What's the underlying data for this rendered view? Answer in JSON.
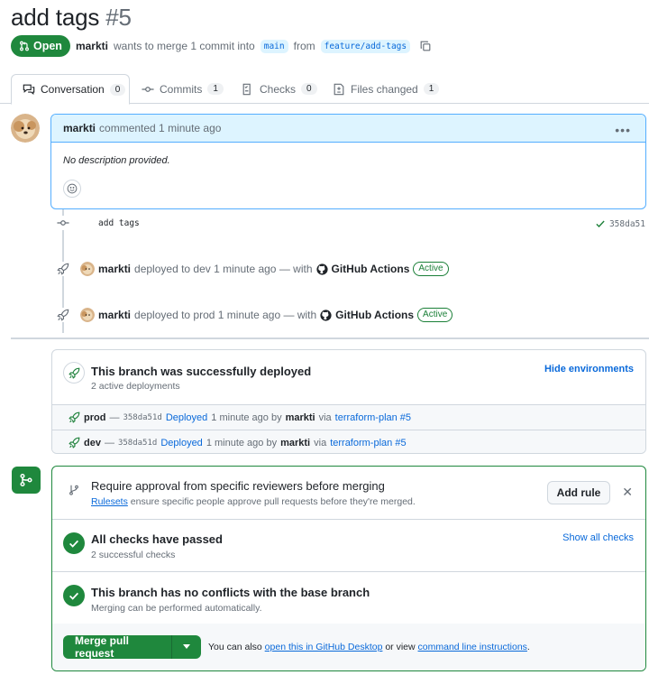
{
  "pr": {
    "title": "add tags",
    "number": "#5",
    "status": "Open",
    "author": "markti",
    "merge_text": "wants to merge 1 commit into",
    "base_branch": "main",
    "from_text": "from",
    "head_branch": "feature/add-tags"
  },
  "tabs": [
    {
      "label": "Conversation",
      "count": "0",
      "icon": "comment-discussion-icon"
    },
    {
      "label": "Commits",
      "count": "1",
      "icon": "git-commit-icon"
    },
    {
      "label": "Checks",
      "count": "0",
      "icon": "checklist-icon"
    },
    {
      "label": "Files changed",
      "count": "1",
      "icon": "file-diff-icon"
    }
  ],
  "comment": {
    "author": "markti",
    "action": "commented 1 minute ago",
    "body": "No description provided."
  },
  "commit": {
    "message": "add tags",
    "sha": "358da51"
  },
  "deploy_events": [
    {
      "user": "markti",
      "text_pre": "deployed to dev 1 minute ago — with",
      "app": "GitHub Actions",
      "badge": "Active"
    },
    {
      "user": "markti",
      "text_pre": "deployed to prod 1 minute ago — with",
      "app": "GitHub Actions",
      "badge": "Active"
    }
  ],
  "deploy_box": {
    "title": "This branch was successfully deployed",
    "subtitle": "2 active deployments",
    "hide_link": "Hide environments",
    "rows": [
      {
        "env": "prod",
        "sha": "358da51d",
        "status": "Deployed",
        "time": "1 minute ago by",
        "user": "markti",
        "via": "via",
        "workflow": "terraform-plan #5"
      },
      {
        "env": "dev",
        "sha": "358da51d",
        "status": "Deployed",
        "time": "1 minute ago by",
        "user": "markti",
        "via": "via",
        "workflow": "terraform-plan #5"
      }
    ]
  },
  "merge_box": {
    "rules_title": "Require approval from specific reviewers before merging",
    "rules_link": "Rulesets",
    "rules_sub": "ensure specific people approve pull requests before they're merged.",
    "add_rule": "Add rule",
    "checks_title": "All checks have passed",
    "checks_sub": "2 successful checks",
    "show_all": "Show all checks",
    "conflicts_title": "This branch has no conflicts with the base branch",
    "conflicts_sub": "Merging can be performed automatically.",
    "merge_button": "Merge pull request",
    "footer_pre": "You can also",
    "footer_link1": "open this in GitHub Desktop",
    "footer_mid": "or view",
    "footer_link2": "command line instructions",
    "footer_end": "."
  },
  "colors": {
    "green": "#1f883d",
    "blue": "#0969da",
    "muted": "#656d76"
  }
}
